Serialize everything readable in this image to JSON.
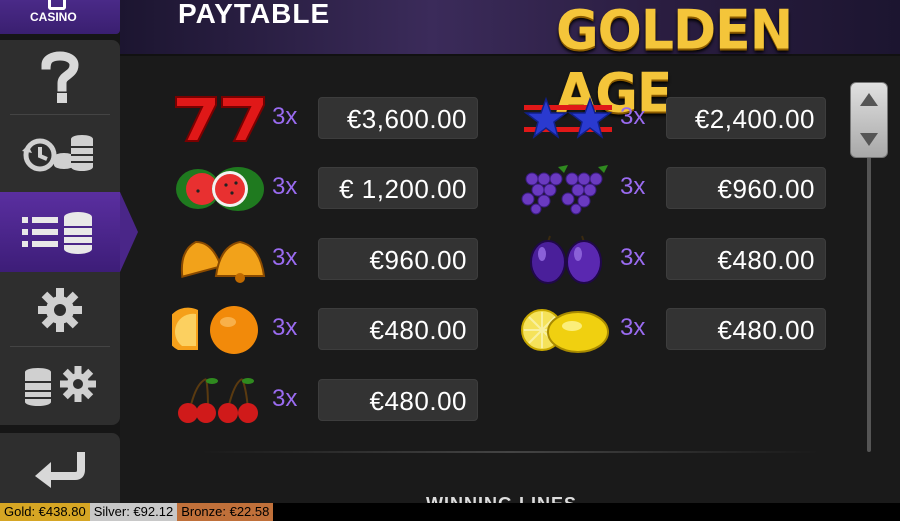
{
  "sidebar": {
    "casino_label": "CASINO",
    "items": [
      {
        "icon": "help-icon"
      },
      {
        "icon": "history-icon"
      },
      {
        "icon": "paytable-icon",
        "active": true
      },
      {
        "icon": "settings-icon"
      },
      {
        "icon": "bet-settings-icon"
      },
      {
        "icon": "back-arrow-icon"
      }
    ]
  },
  "header": {
    "title": "PAYTABLE",
    "game_logo": "GOLDEN AGE"
  },
  "paytable": [
    {
      "symbol": "sevens-symbol",
      "multiplier": "3x",
      "amount": "€3,600.00"
    },
    {
      "symbol": "stars-symbol",
      "multiplier": "3x",
      "amount": "€2,400.00"
    },
    {
      "symbol": "watermelon-symbol",
      "multiplier": "3x",
      "amount": "€ 1,200.00"
    },
    {
      "symbol": "grapes-symbol",
      "multiplier": "3x",
      "amount": "€960.00"
    },
    {
      "symbol": "bells-symbol",
      "multiplier": "3x",
      "amount": "€960.00"
    },
    {
      "symbol": "plums-symbol",
      "multiplier": "3x",
      "amount": "€480.00"
    },
    {
      "symbol": "oranges-symbol",
      "multiplier": "3x",
      "amount": "€480.00"
    },
    {
      "symbol": "lemons-symbol",
      "multiplier": "3x",
      "amount": "€480.00"
    },
    {
      "symbol": "cherries-symbol",
      "multiplier": "3x",
      "amount": "€480.00"
    }
  ],
  "next_section": "WINNING LINES",
  "jackpots": {
    "gold": "Gold: €438.80",
    "silver": "Silver: €92.12",
    "bronze": "Bronze: €22.58"
  },
  "colors": {
    "accent_purple": "#9a6bf0",
    "logo_gold": "#f4c53a",
    "sidebar_active": "#4a2688"
  }
}
